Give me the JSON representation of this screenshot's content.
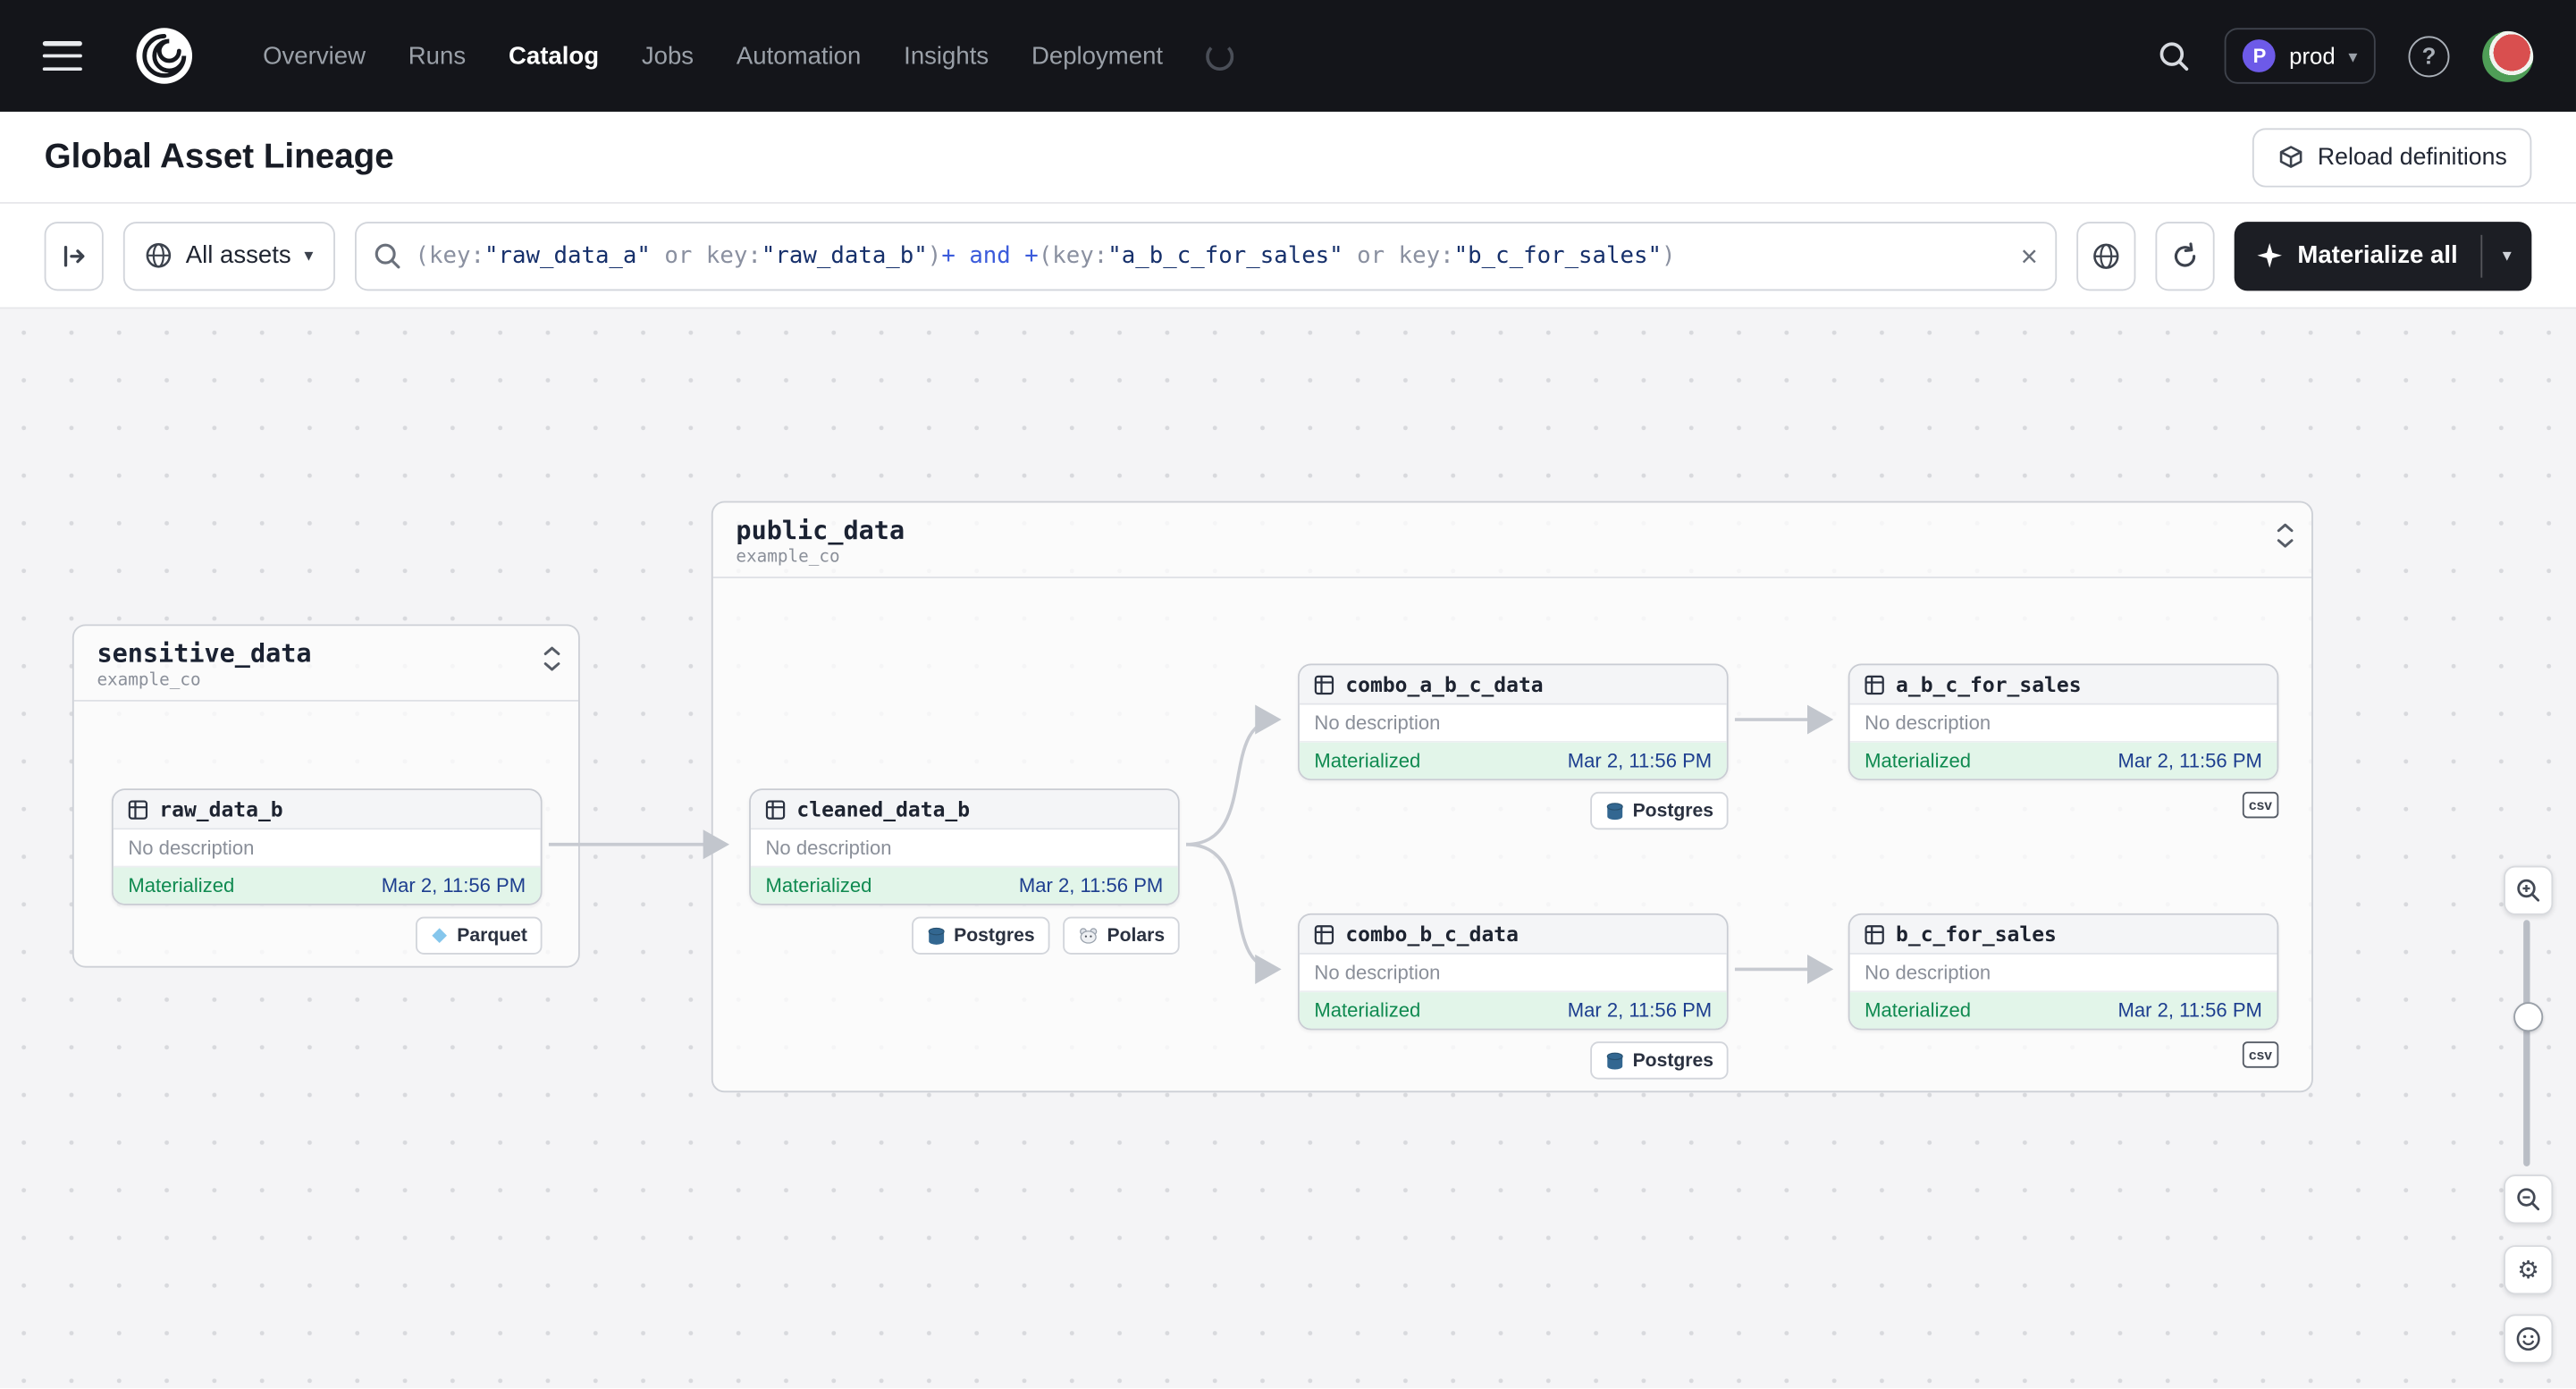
{
  "navbar": {
    "links": [
      {
        "label": "Overview"
      },
      {
        "label": "Runs"
      },
      {
        "label": "Catalog"
      },
      {
        "label": "Jobs"
      },
      {
        "label": "Automation"
      },
      {
        "label": "Insights"
      },
      {
        "label": "Deployment"
      }
    ],
    "active_link": "Catalog",
    "env": {
      "initial": "P",
      "name": "prod"
    }
  },
  "header": {
    "title": "Global Asset Lineage",
    "reload_button_label": "Reload definitions"
  },
  "toolbar": {
    "scope_button_label": "All assets",
    "materialize_button_label": "Materialize all",
    "query": {
      "full_text": "(key:\"raw_data_a\" or key:\"raw_data_b\")+ and +(key:\"a_b_c_for_sales\" or key:\"b_c_for_sales\")",
      "segments": [
        {
          "text": "(key:",
          "tone": "gray"
        },
        {
          "text": "\"raw_data_a\"",
          "tone": "navy"
        },
        {
          "text": " or ",
          "tone": "gray"
        },
        {
          "text": "key:",
          "tone": "gray"
        },
        {
          "text": "\"raw_data_b\"",
          "tone": "navy"
        },
        {
          "text": ")",
          "tone": "gray"
        },
        {
          "text": "+",
          "tone": "blue"
        },
        {
          "text": " and ",
          "tone": "blue"
        },
        {
          "text": "+",
          "tone": "blue"
        },
        {
          "text": "(key:",
          "tone": "gray"
        },
        {
          "text": "\"a_b_c_for_sales\"",
          "tone": "navy"
        },
        {
          "text": " or ",
          "tone": "gray"
        },
        {
          "text": "key:",
          "tone": "gray"
        },
        {
          "text": "\"b_c_for_sales\"",
          "tone": "navy"
        },
        {
          "text": ")",
          "tone": "gray"
        }
      ]
    }
  },
  "canvas": {
    "groups": [
      {
        "title": "sensitive_data",
        "subtitle": "example_co"
      },
      {
        "title": "public_data",
        "subtitle": "example_co"
      }
    ],
    "nodes": [
      {
        "name": "raw_data_b",
        "description": "No description",
        "status": "Materialized",
        "timestamp": "Mar 2, 11:56 PM"
      },
      {
        "name": "cleaned_data_b",
        "description": "No description",
        "status": "Materialized",
        "timestamp": "Mar 2, 11:56 PM"
      },
      {
        "name": "combo_a_b_c_data",
        "description": "No description",
        "status": "Materialized",
        "timestamp": "Mar 2, 11:56 PM"
      },
      {
        "name": "a_b_c_for_sales",
        "description": "No description",
        "status": "Materialized",
        "timestamp": "Mar 2, 11:56 PM"
      },
      {
        "name": "combo_b_c_data",
        "description": "No description",
        "status": "Materialized",
        "timestamp": "Mar 2, 11:56 PM"
      },
      {
        "name": "b_c_for_sales",
        "description": "No description",
        "status": "Materialized",
        "timestamp": "Mar 2, 11:56 PM"
      }
    ],
    "tags": {
      "parquet": "Parquet",
      "postgres": "Postgres",
      "polars": "Polars",
      "csv": "csv"
    }
  },
  "colors": {
    "navbar_bg": "#14151a",
    "status_green": "#0f8a50",
    "status_bg": "#e2f5e9",
    "timestamp_navy": "#1d3e8f",
    "materialize_button_bg": "#1c1e24",
    "env_badge_purple": "#6d5ae8"
  }
}
